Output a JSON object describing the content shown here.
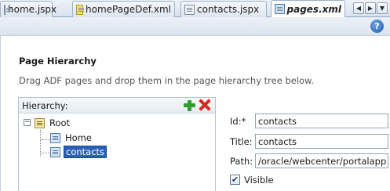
{
  "tabs": [
    {
      "label": "home.jspx",
      "icon": "jspx-file-icon"
    },
    {
      "label": "homePageDef.xml",
      "icon": "xml-pagedef-icon"
    },
    {
      "label": "contacts.jspx",
      "icon": "jspx-file-icon"
    },
    {
      "label": "pages.xml",
      "icon": "pages-xml-icon",
      "active": true
    }
  ],
  "tab_nav": {
    "prev": "◀",
    "next": "▶",
    "menu": "▼"
  },
  "toolbar": {
    "help": "?"
  },
  "editor": {
    "title": "Page Hierarchy",
    "description": "Drag ADF pages and drop them in the page hierarchy tree below."
  },
  "hierarchy": {
    "label": "Hierarchy:",
    "tree": {
      "root": {
        "label": "Root",
        "expander": "−"
      },
      "children": [
        {
          "label": "Home"
        },
        {
          "label": "contacts",
          "selected": true
        }
      ]
    }
  },
  "properties": {
    "id": {
      "label": "Id:*",
      "value": "contacts"
    },
    "title": {
      "label": "Title:",
      "value": "contacts"
    },
    "path": {
      "label": "Path:",
      "value": "/oracle/webcenter/portalapp"
    },
    "visible": {
      "label": "Visible",
      "checked": true,
      "mark": "✔"
    }
  }
}
